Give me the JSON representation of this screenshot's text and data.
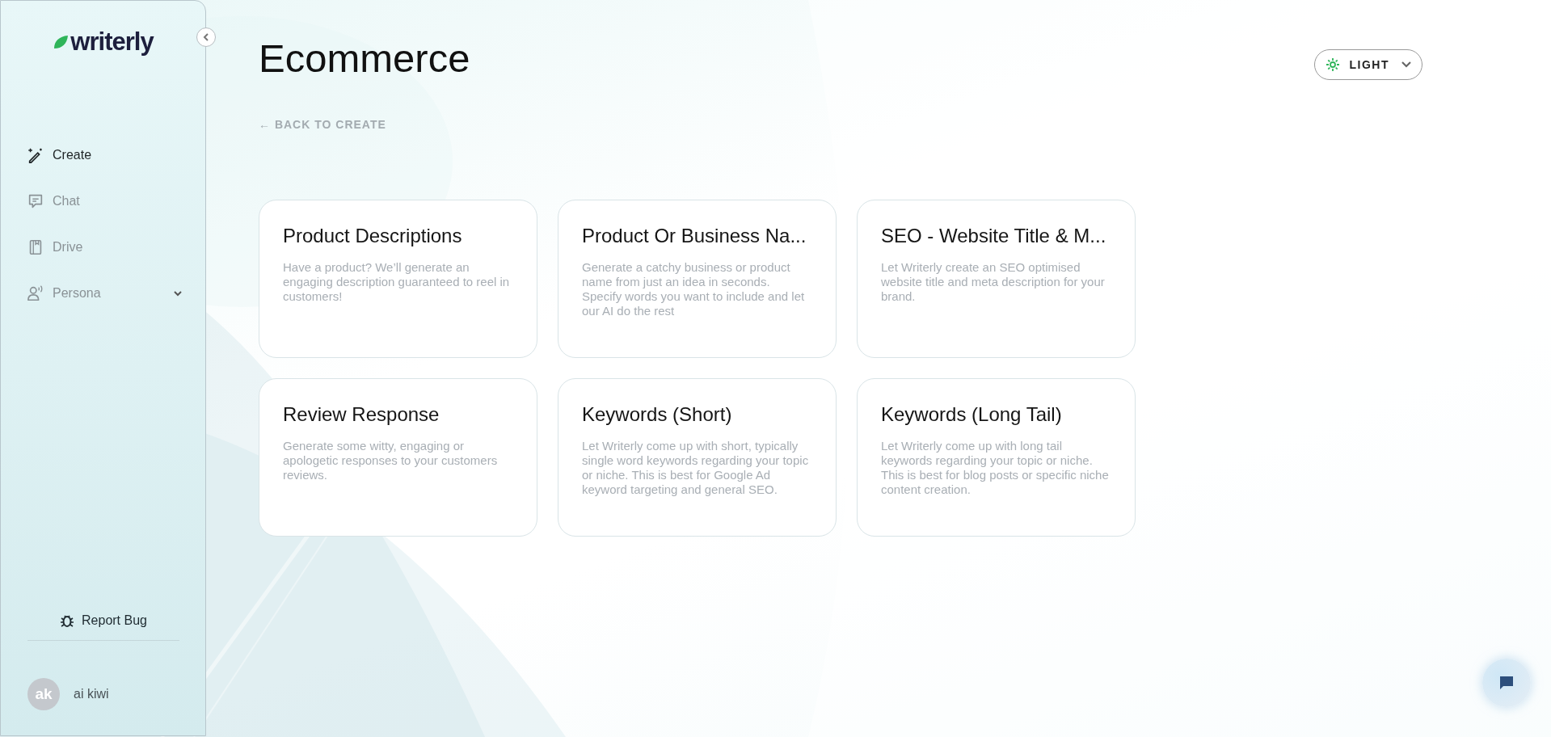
{
  "sidebar": {
    "logo": "writerly",
    "items": [
      {
        "label": "Create",
        "kind": "create",
        "selected": true
      },
      {
        "label": "Chat",
        "kind": "chat",
        "selected": false
      },
      {
        "label": "Drive",
        "kind": "drive",
        "selected": false
      },
      {
        "label": "Persona",
        "kind": "persona",
        "selected": false,
        "expanded": false
      }
    ],
    "report_bug": "Report Bug",
    "user": {
      "initials": "ak",
      "name": "ai kiwi"
    }
  },
  "header": {
    "title": "Ecommerce",
    "back_link": "← BACK TO CREATE",
    "theme": "LIGHT"
  },
  "cards": [
    {
      "title": "Product Descriptions",
      "description": "Have a product? We’ll generate an engaging description guaranteed to reel in customers!"
    },
    {
      "title": "Product Or Business Na...",
      "description": "Generate a catchy business or product name from just an idea in seconds. Specify words you want to include and let our AI do the rest"
    },
    {
      "title": "SEO - Website Title & M...",
      "description": "Let Writerly create an SEO optimised website title and meta description for your brand."
    },
    {
      "title": "Review Response",
      "description": "Generate some witty, engaging or apologetic responses to your customers reviews."
    },
    {
      "title": "Keywords (Short)",
      "description": "Let Writerly come up with short, typically single word keywords regarding your topic or niche. This is best for Google Ad keyword targeting and general SEO."
    },
    {
      "title": "Keywords (Long Tail)",
      "description": "Let Writerly come up with long tail keywords regarding your topic or niche. This is best for blog posts or specific niche content creation."
    }
  ]
}
